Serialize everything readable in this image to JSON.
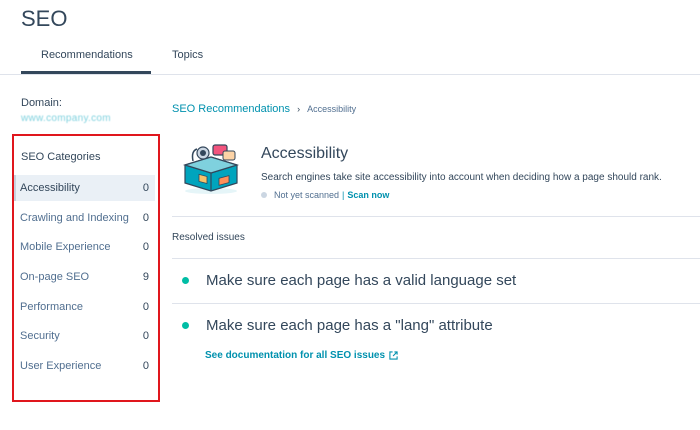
{
  "header": {
    "title": "SEO"
  },
  "tabs": [
    {
      "label": "Recommendations",
      "active": true
    },
    {
      "label": "Topics",
      "active": false
    }
  ],
  "domain": {
    "label": "Domain:",
    "value": "www.company.com"
  },
  "categories": {
    "heading": "SEO Categories",
    "items": [
      {
        "name": "Accessibility",
        "count": "0",
        "active": true
      },
      {
        "name": "Crawling and Indexing",
        "count": "0"
      },
      {
        "name": "Mobile Experience",
        "count": "0"
      },
      {
        "name": "On-page SEO",
        "count": "9"
      },
      {
        "name": "Performance",
        "count": "0"
      },
      {
        "name": "Security",
        "count": "0"
      },
      {
        "name": "User Experience",
        "count": "0"
      }
    ]
  },
  "breadcrumb": {
    "root": "SEO Recommendations",
    "separator": "›",
    "current": "Accessibility"
  },
  "main": {
    "title": "Accessibility",
    "description": "Search engines take site accessibility into account when deciding how a page should rank.",
    "status": "Not yet scanned",
    "status_separator": "|",
    "scan_label": "Scan now",
    "resolved_label": "Resolved issues",
    "issues": [
      {
        "text": "Make sure each page has a valid language set"
      },
      {
        "text": "Make sure each page has a \"lang\" attribute"
      }
    ],
    "doc_link": "See documentation for all SEO issues"
  },
  "colors": {
    "accent": "#0091ae",
    "text": "#33475b",
    "resolved_dot": "#00bda5",
    "highlight": "#e0161d"
  }
}
